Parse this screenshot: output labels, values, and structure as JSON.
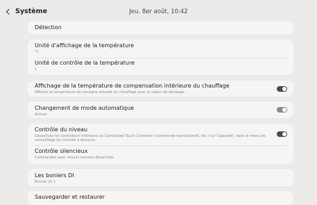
{
  "header": {
    "back_label": "Système",
    "datetime": "Jeu. 8er août, 10:42"
  },
  "items": {
    "detection": {
      "title": "Détection"
    },
    "temp_display_unit": {
      "title": "Unité d'affichage de la température",
      "sub": "°C"
    },
    "temp_control_unit": {
      "title": "Unité de contrôle de la température",
      "sub": "1"
    },
    "heating_comp_display": {
      "title": "Affichage de la température de compensation intérieure du chauffage",
      "sub": "Affichez la température de consigne actuelle du chauffage avec la valeur de décalage.",
      "toggle": "off"
    },
    "auto_mode_change": {
      "title": "Changement de mode automatique",
      "sub": "Activer",
      "toggle": "on"
    },
    "level_control": {
      "title": "Contrôle du niveau",
      "sub": "Désactivez les contrôleurs inférieurs au Centralized Touch Controller (commande marche/arrêt, etc.) sur l'appareil), dans le menu de verrouillage du contrôle à distance.",
      "toggle": "off"
    },
    "silent_control": {
      "title": "Contrôle silencieux",
      "sub": "Commandes avec retours sonores désactivés."
    },
    "di_terminals": {
      "title": "Les boniers DI",
      "sub": "Bornier DI 1"
    },
    "backup_restore": {
      "title": "Sauvegarder et restaurer"
    }
  }
}
